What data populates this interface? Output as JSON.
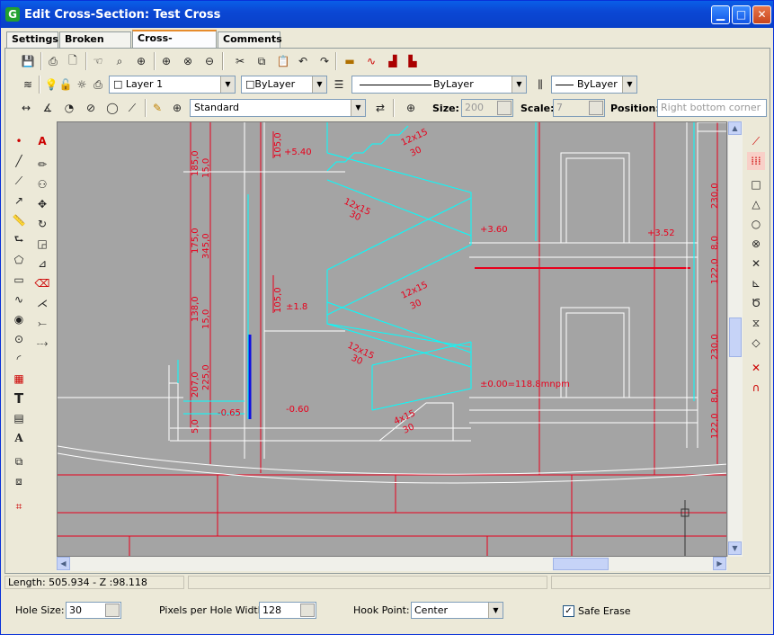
{
  "window": {
    "title": "Edit Cross-Section: Test Cross",
    "app_icon": "G"
  },
  "tabs": [
    {
      "label": "Settings"
    },
    {
      "label": "Broken Line"
    },
    {
      "label": "Cross-Section"
    },
    {
      "label": "Comments"
    }
  ],
  "active_tab": "Cross-Section",
  "layer_bar": {
    "layer": "Layer 1",
    "color": "ByLayer",
    "linetype": "ByLayer",
    "lineweight": "ByLayer"
  },
  "text_bar": {
    "style": "Standard",
    "size_label": "Size:",
    "size_value": "200",
    "scale_label": "Scale:",
    "scale_value": "7",
    "position_label": "Position:",
    "position_placeholder": "Right bottom corner"
  },
  "drawing_labels": [
    {
      "text": "+5.40"
    },
    {
      "text": "12x15"
    },
    {
      "text": "30"
    },
    {
      "text": "+3.60"
    },
    {
      "text": "+3.52"
    },
    {
      "text": "±1.8"
    },
    {
      "text": "±0.00=118.8mnpm"
    },
    {
      "text": "-0.65"
    },
    {
      "text": "-0.60"
    },
    {
      "text": "185,0"
    },
    {
      "text": "15,0"
    },
    {
      "text": "175,0"
    },
    {
      "text": "345,0"
    },
    {
      "text": "138,0"
    },
    {
      "text": "105,0"
    },
    {
      "text": "207,0"
    },
    {
      "text": "225,0"
    },
    {
      "text": "230,0"
    },
    {
      "text": "122,0"
    },
    {
      "text": "8,0"
    },
    {
      "text": "5,0"
    },
    {
      "text": "4x15"
    }
  ],
  "status": {
    "length": "Length: 505.934  - Z :98.118"
  },
  "bottom": {
    "hole_size_label": "Hole Size:",
    "hole_size_value": "30",
    "pixels_label": "Pixels per Hole Width:",
    "pixels_value": "128",
    "hook_label": "Hook Point:",
    "hook_value": "Center",
    "safe_erase_label": "Safe Erase",
    "safe_erase_checked": "✓"
  },
  "colors": {
    "canvas": "#a4a4a4",
    "dim_red": "#e8001c",
    "stair_cyan": "#00ffff",
    "wall_white": "#ffffff"
  }
}
